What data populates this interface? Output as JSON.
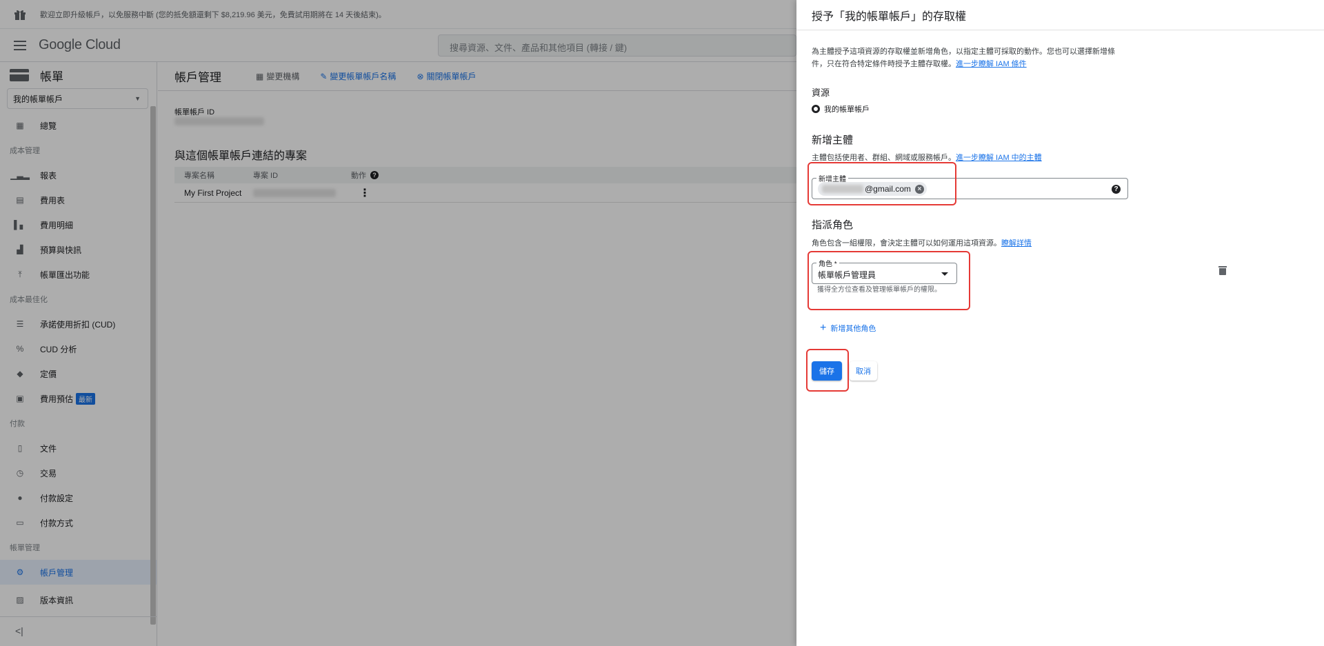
{
  "promo": {
    "text": "歡迎立即升級帳戶，以免服務中斷 (您的抵免額還剩下 $8,219.96 美元，免費試用期將在 14 天後結束)。"
  },
  "topbar": {
    "logo": "Google Cloud",
    "search_placeholder": "搜尋資源、文件、產品和其他項目 (轉接 / 鍵)"
  },
  "sidebar": {
    "title": "帳單",
    "account_select": "我的帳單帳戶",
    "items": [
      {
        "label": "總覽",
        "icon": "dashboard-icon"
      },
      {
        "section": "成本管理"
      },
      {
        "label": "報表",
        "icon": "bar-chart-icon"
      },
      {
        "label": "費用表",
        "icon": "table-icon"
      },
      {
        "label": "費用明細",
        "icon": "breakdown-icon"
      },
      {
        "label": "預算與快訊",
        "icon": "budget-icon"
      },
      {
        "label": "帳單匯出功能",
        "icon": "export-icon"
      },
      {
        "section": "成本最佳化"
      },
      {
        "label": "承諾使用折扣 (CUD)",
        "icon": "list-icon"
      },
      {
        "label": "CUD 分析",
        "icon": "percent-icon"
      },
      {
        "label": "定價",
        "icon": "tag-icon"
      },
      {
        "label": "費用預估",
        "icon": "calculator-icon",
        "badge": "最新"
      },
      {
        "section": "付款"
      },
      {
        "label": "文件",
        "icon": "document-icon"
      },
      {
        "label": "交易",
        "icon": "clock-icon"
      },
      {
        "label": "付款設定",
        "icon": "person-icon"
      },
      {
        "label": "付款方式",
        "icon": "credit-card-icon"
      },
      {
        "section": "帳單管理"
      },
      {
        "label": "帳戶管理",
        "icon": "gear-icon",
        "active": true
      }
    ],
    "release_notes": "版本資訊",
    "collapse": "<|"
  },
  "main": {
    "title": "帳戶管理",
    "actions": {
      "change_org": "變更機構",
      "rename": "變更帳單帳戶名稱",
      "close": "關閉帳單帳戶"
    },
    "account_id_label": "帳單帳戶 ID",
    "projects_title": "與這個帳單帳戶連結的專案",
    "table": {
      "headers": [
        "專案名稱",
        "專案 ID",
        "動作"
      ],
      "rows": [
        {
          "name": "My First Project"
        }
      ]
    }
  },
  "panel": {
    "title": "授予「我的帳單帳戶」的存取權",
    "description": "為主體授予這項資源的存取權並新增角色，以指定主體可採取的動作。您也可以選擇新增條件，只在符合特定條件時授予主體存取權。",
    "description_link": "進一步瞭解 IAM 條件",
    "resource_label": "資源",
    "resource_value": "我的帳單帳戶",
    "principal_heading": "新增主體",
    "principal_sub": "主體包括使用者、群組、網域或服務帳戶。",
    "principal_sub_link": "進一步瞭解 IAM 中的主體",
    "principal_field_label": "新增主體",
    "principal_chip": "@gmail.com",
    "role_heading": "指派角色",
    "role_sub": "角色包含一組權限，會決定主體可以如何運用這項資源。",
    "role_sub_link": "瞭解詳情",
    "role_field_label": "角色 *",
    "role_value": "帳單帳戶管理員",
    "role_hint": "獲得全方位查看及管理帳單帳戶的權限。",
    "add_role": "新增其他角色",
    "save": "儲存",
    "cancel": "取消"
  },
  "colors": {
    "accent": "#1a73e8",
    "highlight": "#e53935",
    "overlay": "rgba(0,0,0,0.32)"
  }
}
